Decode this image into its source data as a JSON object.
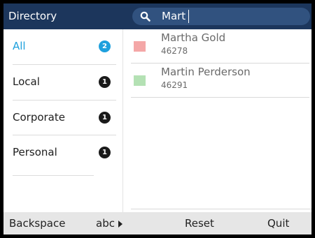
{
  "header": {
    "title": "Directory",
    "search": {
      "value": "Mart",
      "icon": "search-icon"
    }
  },
  "categories": [
    {
      "label": "All",
      "count": "2",
      "active": true
    },
    {
      "label": "Local",
      "count": "1"
    },
    {
      "label": "Corporate",
      "count": "1"
    },
    {
      "label": "Personal",
      "count": "1"
    }
  ],
  "results": [
    {
      "name": "Martha Gold",
      "number": "46278",
      "color": "#f4a7a7"
    },
    {
      "name": "Martin Perderson",
      "number": "46291",
      "color": "#b4e1b4"
    }
  ],
  "softkeys": {
    "backspace": "Backspace",
    "abc": "abc",
    "reset": "Reset",
    "quit": "Quit"
  },
  "colors": {
    "header_bg": "#1c365c",
    "search_bg": "#31527f",
    "accent": "#1ea0dd",
    "softkey_bg": "#e6e6e6"
  }
}
